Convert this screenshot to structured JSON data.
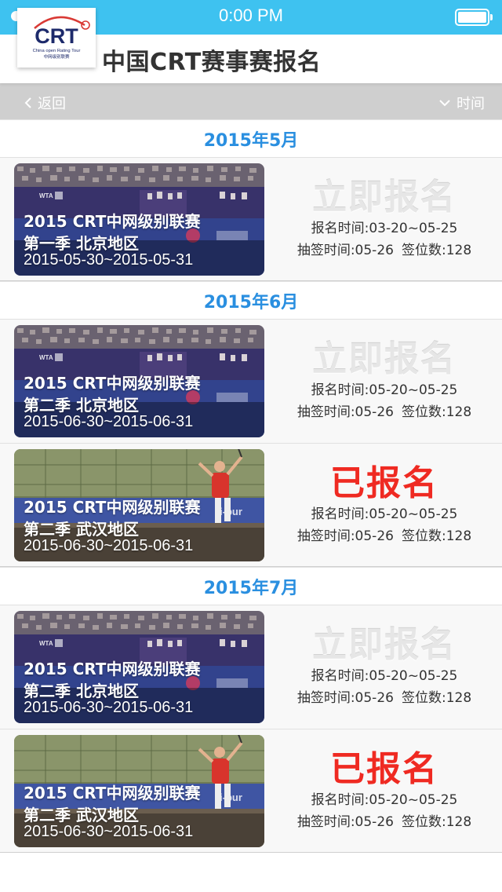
{
  "status_bar": {
    "time": "0:00 PM",
    "signal_dots": 5,
    "battery_level": 1.0
  },
  "header": {
    "title": "中国CRT赛事赛报名",
    "logo": {
      "text": "CRT",
      "tagline": "China open Rating Tour",
      "tagline_cn": "中网级别联赛"
    }
  },
  "subnav": {
    "back_label": "返回",
    "sort_label": "时间"
  },
  "colors": {
    "status_bar": "#3ec2f0",
    "month": "#2a8fe0",
    "registered": "#ef2a22",
    "open_label": "#e6e6e6",
    "subnav": "#cfcfcf"
  },
  "groups": [
    {
      "month": "2015年5月",
      "events": [
        {
          "line1": "2015 CRT中网级别联赛",
          "line2": "第一季  北京地区",
          "dates": "2015-05-30~2015-05-31",
          "status": "立即报名",
          "state": "open",
          "reg_time": "报名时间:03-20~05-25",
          "draw_time": "抽签时间:05-26",
          "slots": "签位数:128",
          "image": "stadium-court"
        }
      ]
    },
    {
      "month": "2015年6月",
      "events": [
        {
          "line1": "2015 CRT中网级别联赛",
          "line2": "第二季  北京地区",
          "dates": "2015-06-30~2015-06-31",
          "status": "立即报名",
          "state": "open",
          "reg_time": "报名时间:05-20~05-25",
          "draw_time": "抽签时间:05-26",
          "slots": "签位数:128",
          "image": "stadium-court"
        },
        {
          "line1": "2015 CRT中网级别联赛",
          "line2": "第二季  武汉地区",
          "dates": "2015-06-30~2015-06-31",
          "status": "已报名",
          "state": "registered",
          "reg_time": "报名时间:05-20~05-25",
          "draw_time": "抽签时间:05-26",
          "slots": "签位数:128",
          "image": "outdoor-serve"
        }
      ]
    },
    {
      "month": "2015年7月",
      "events": [
        {
          "line1": "2015 CRT中网级别联赛",
          "line2": "第二季  北京地区",
          "dates": "2015-06-30~2015-06-31",
          "status": "立即报名",
          "state": "open",
          "reg_time": "报名时间:05-20~05-25",
          "draw_time": "抽签时间:05-26",
          "slots": "签位数:128",
          "image": "stadium-court"
        },
        {
          "line1": "2015 CRT中网级别联赛",
          "line2": "第二季  武汉地区",
          "dates": "2015-06-30~2015-06-31",
          "status": "已报名",
          "state": "registered",
          "reg_time": "报名时间:05-20~05-25",
          "draw_time": "抽签时间:05-26",
          "slots": "签位数:128",
          "image": "outdoor-serve"
        }
      ]
    }
  ]
}
